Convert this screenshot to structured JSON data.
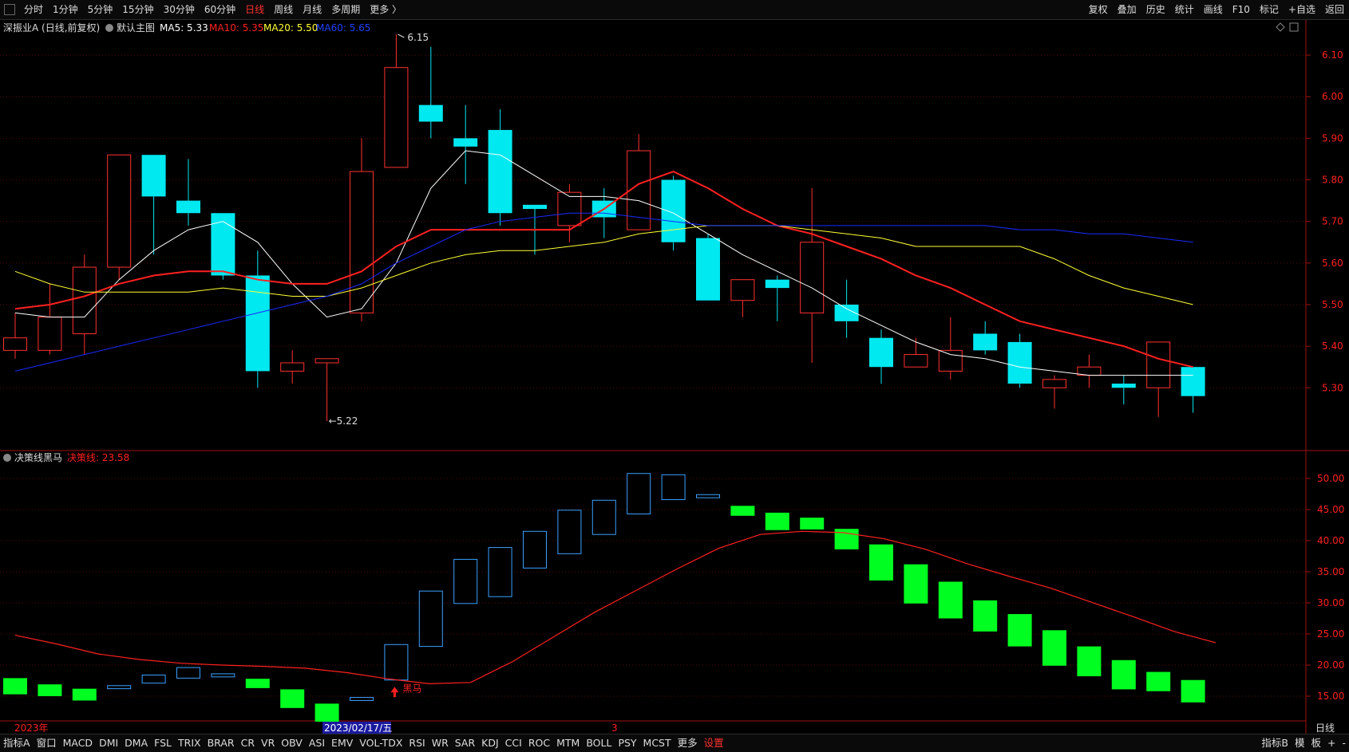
{
  "topbar": {
    "periods": [
      "分时",
      "1分钟",
      "5分钟",
      "15分钟",
      "30分钟",
      "60分钟",
      "日线",
      "周线",
      "月线",
      "多周期",
      "更多 〉"
    ],
    "active_period": "日线",
    "tools": [
      "复权",
      "叠加",
      "历史",
      "统计",
      "画线",
      "F10",
      "标记",
      "+自选",
      "返回"
    ]
  },
  "main_panel": {
    "stock": "深振业A (日线,前复权)",
    "indicator": "默认主图",
    "ma": [
      {
        "label": "MA5: 5.33",
        "color": "#ffffff"
      },
      {
        "label": "MA10: 5.35",
        "color": "#ff2020"
      },
      {
        "label": "MA20: 5.50",
        "color": "#ffff33"
      },
      {
        "label": "MA60: 5.65",
        "color": "#2040ff"
      }
    ],
    "high_mark": "6.15",
    "low_mark": "←5.22",
    "y_ticks": [
      "6.10",
      "6.00",
      "5.90",
      "5.80",
      "5.70",
      "5.60",
      "5.50",
      "5.40",
      "5.30"
    ]
  },
  "sub_panel": {
    "name": "决策线黑马",
    "value_label": "决策线: 23.58",
    "signal_label": "黑马",
    "y_ticks": [
      "50.00",
      "45.00",
      "40.00",
      "35.00",
      "30.00",
      "25.00",
      "20.00",
      "15.00"
    ]
  },
  "x_axis": {
    "year": "2023年",
    "cursor_date": "2023/02/17/五",
    "month_mark": "3"
  },
  "right_label": "日线",
  "bottombar": {
    "items": [
      "指标A",
      "窗口",
      "MACD",
      "DMI",
      "DMA",
      "FSL",
      "TRIX",
      "BRAR",
      "CR",
      "VR",
      "OBV",
      "ASI",
      "EMV",
      "VOL-TDX",
      "RSI",
      "WR",
      "SAR",
      "KDJ",
      "CCI",
      "ROC",
      "MTM",
      "BOLL",
      "PSY",
      "MCST",
      "更多",
      "设置"
    ],
    "right_items": [
      "指标B",
      "模",
      "板",
      "+",
      "-"
    ]
  },
  "chart_data": [
    {
      "type": "candlestick",
      "ylim": [
        5.2,
        6.15
      ],
      "candles": [
        {
          "o": 5.39,
          "c": 5.42,
          "h": 5.48,
          "l": 5.37
        },
        {
          "o": 5.39,
          "c": 5.47,
          "h": 5.55,
          "l": 5.38
        },
        {
          "o": 5.43,
          "c": 5.59,
          "h": 5.62,
          "l": 5.38
        },
        {
          "o": 5.59,
          "c": 5.86,
          "h": 5.86,
          "l": 5.56
        },
        {
          "o": 5.86,
          "c": 5.76,
          "h": 5.86,
          "l": 5.62
        },
        {
          "o": 5.75,
          "c": 5.72,
          "h": 5.85,
          "l": 5.69
        },
        {
          "o": 5.72,
          "c": 5.57,
          "h": 5.72,
          "l": 5.56
        },
        {
          "o": 5.57,
          "c": 5.34,
          "h": 5.63,
          "l": 5.3
        },
        {
          "o": 5.34,
          "c": 5.36,
          "h": 5.39,
          "l": 5.31
        },
        {
          "o": 5.36,
          "c": 5.37,
          "h": 5.37,
          "l": 5.22
        },
        {
          "o": 5.48,
          "c": 5.82,
          "h": 5.9,
          "l": 5.46
        },
        {
          "o": 5.83,
          "c": 6.07,
          "h": 6.15,
          "l": 5.83
        },
        {
          "o": 5.98,
          "c": 5.94,
          "h": 6.12,
          "l": 5.9
        },
        {
          "o": 5.9,
          "c": 5.88,
          "h": 5.98,
          "l": 5.79
        },
        {
          "o": 5.92,
          "c": 5.72,
          "h": 5.97,
          "l": 5.69
        },
        {
          "o": 5.74,
          "c": 5.73,
          "h": 5.74,
          "l": 5.62
        },
        {
          "o": 5.69,
          "c": 5.77,
          "h": 5.79,
          "l": 5.65
        },
        {
          "o": 5.75,
          "c": 5.71,
          "h": 5.78,
          "l": 5.66
        },
        {
          "o": 5.68,
          "c": 5.87,
          "h": 5.91,
          "l": 5.68
        },
        {
          "o": 5.8,
          "c": 5.65,
          "h": 5.81,
          "l": 5.63
        },
        {
          "o": 5.66,
          "c": 5.51,
          "h": 5.67,
          "l": 5.51
        },
        {
          "o": 5.51,
          "c": 5.56,
          "h": 5.56,
          "l": 5.47
        },
        {
          "o": 5.56,
          "c": 5.54,
          "h": 5.57,
          "l": 5.46
        },
        {
          "o": 5.48,
          "c": 5.65,
          "h": 5.78,
          "l": 5.36
        },
        {
          "o": 5.5,
          "c": 5.46,
          "h": 5.56,
          "l": 5.42
        },
        {
          "o": 5.42,
          "c": 5.35,
          "h": 5.44,
          "l": 5.31
        },
        {
          "o": 5.35,
          "c": 5.38,
          "h": 5.42,
          "l": 5.35
        },
        {
          "o": 5.34,
          "c": 5.39,
          "h": 5.47,
          "l": 5.32
        },
        {
          "o": 5.43,
          "c": 5.39,
          "h": 5.46,
          "l": 5.38
        },
        {
          "o": 5.41,
          "c": 5.31,
          "h": 5.43,
          "l": 5.3
        },
        {
          "o": 5.3,
          "c": 5.32,
          "h": 5.33,
          "l": 5.25
        },
        {
          "o": 5.33,
          "c": 5.35,
          "h": 5.38,
          "l": 5.3
        },
        {
          "o": 5.31,
          "c": 5.3,
          "h": 5.33,
          "l": 5.26
        },
        {
          "o": 5.3,
          "c": 5.41,
          "h": 5.41,
          "l": 5.23
        },
        {
          "o": 5.35,
          "c": 5.28,
          "h": 5.35,
          "l": 5.24
        }
      ],
      "ma": [
        {
          "name": "MA5",
          "color": "#ffffff",
          "width": 1,
          "values": [
            5.48,
            5.47,
            5.47,
            5.56,
            5.63,
            5.68,
            5.7,
            5.65,
            5.55,
            5.47,
            5.49,
            5.6,
            5.78,
            5.87,
            5.86,
            5.81,
            5.76,
            5.76,
            5.75,
            5.72,
            5.67,
            5.62,
            5.58,
            5.54,
            5.49,
            5.45,
            5.41,
            5.38,
            5.37,
            5.35,
            5.34,
            5.33,
            5.33,
            5.33,
            5.33
          ]
        },
        {
          "name": "MA10",
          "color": "#ff2020",
          "width": 2,
          "values": [
            5.49,
            5.5,
            5.52,
            5.55,
            5.57,
            5.58,
            5.58,
            5.56,
            5.55,
            5.55,
            5.58,
            5.64,
            5.68,
            5.68,
            5.68,
            5.68,
            5.68,
            5.73,
            5.79,
            5.82,
            5.78,
            5.73,
            5.69,
            5.67,
            5.64,
            5.61,
            5.57,
            5.54,
            5.5,
            5.46,
            5.44,
            5.42,
            5.4,
            5.37,
            5.35
          ]
        },
        {
          "name": "MA20",
          "color": "#ffff33",
          "width": 1,
          "values": [
            5.58,
            5.55,
            5.53,
            5.53,
            5.53,
            5.53,
            5.54,
            5.53,
            5.52,
            5.52,
            5.54,
            5.57,
            5.6,
            5.62,
            5.63,
            5.63,
            5.64,
            5.65,
            5.67,
            5.68,
            5.69,
            5.69,
            5.69,
            5.68,
            5.67,
            5.66,
            5.64,
            5.64,
            5.64,
            5.64,
            5.61,
            5.57,
            5.54,
            5.52,
            5.5
          ]
        },
        {
          "name": "MA60",
          "color": "#1a2aff",
          "width": 1,
          "values": [
            5.34,
            5.36,
            5.38,
            5.4,
            5.42,
            5.44,
            5.46,
            5.48,
            5.5,
            5.52,
            5.55,
            5.6,
            5.64,
            5.68,
            5.7,
            5.71,
            5.72,
            5.72,
            5.71,
            5.7,
            5.69,
            5.69,
            5.69,
            5.69,
            5.69,
            5.69,
            5.69,
            5.69,
            5.69,
            5.68,
            5.68,
            5.67,
            5.67,
            5.66,
            5.65
          ]
        }
      ]
    },
    {
      "type": "bar",
      "ylim": [
        12,
        52
      ],
      "series": [
        {
          "name": "决策线",
          "color": "#ff2020",
          "values": [
            24.8,
            23.4,
            21.8,
            20.9,
            20.3,
            20.0,
            19.8,
            19.5,
            18.8,
            17.8,
            17.0,
            17.2,
            20.5,
            24.5,
            28.5,
            32.0,
            35.5,
            38.8,
            41.0,
            41.5,
            41.3,
            40.3,
            38.6,
            36.3,
            34.3,
            32.4,
            30.1,
            27.8,
            25.4,
            23.6
          ]
        }
      ],
      "bars": [
        {
          "o": 17.9,
          "c": 15.3
        },
        {
          "o": 16.9,
          "c": 15.0
        },
        {
          "o": 16.2,
          "c": 14.3
        },
        {
          "o": 16.2,
          "c": 16.7
        },
        {
          "o": 17.1,
          "c": 18.4
        },
        {
          "o": 17.9,
          "c": 19.6
        },
        {
          "o": 18.1,
          "c": 18.6
        },
        {
          "o": 17.8,
          "c": 16.3
        },
        {
          "o": 16.1,
          "c": 13.1
        },
        {
          "o": 13.8,
          "c": 10.9
        },
        {
          "o": 14.3,
          "c": 14.8
        },
        {
          "o": 17.6,
          "c": 23.3
        },
        {
          "o": 23.0,
          "c": 31.9
        },
        {
          "o": 29.9,
          "c": 37.0
        },
        {
          "o": 31.0,
          "c": 38.9
        },
        {
          "o": 35.6,
          "c": 41.5
        },
        {
          "o": 37.9,
          "c": 44.9
        },
        {
          "o": 41.0,
          "c": 46.5
        },
        {
          "o": 44.3,
          "c": 50.8
        },
        {
          "o": 46.6,
          "c": 50.6
        },
        {
          "o": 46.9,
          "c": 47.4
        },
        {
          "o": 45.6,
          "c": 44.0
        },
        {
          "o": 44.5,
          "c": 41.7
        },
        {
          "o": 43.7,
          "c": 41.8
        },
        {
          "o": 41.9,
          "c": 38.6
        },
        {
          "o": 39.4,
          "c": 33.6
        },
        {
          "o": 36.2,
          "c": 29.9
        },
        {
          "o": 33.4,
          "c": 27.5
        },
        {
          "o": 30.4,
          "c": 25.4
        },
        {
          "o": 28.2,
          "c": 23.0
        },
        {
          "o": 25.6,
          "c": 19.9
        },
        {
          "o": 23.0,
          "c": 18.2
        },
        {
          "o": 20.8,
          "c": 16.1
        },
        {
          "o": 18.9,
          "c": 15.8
        },
        {
          "o": 17.6,
          "c": 14.0
        }
      ],
      "signal_index": 11
    }
  ]
}
